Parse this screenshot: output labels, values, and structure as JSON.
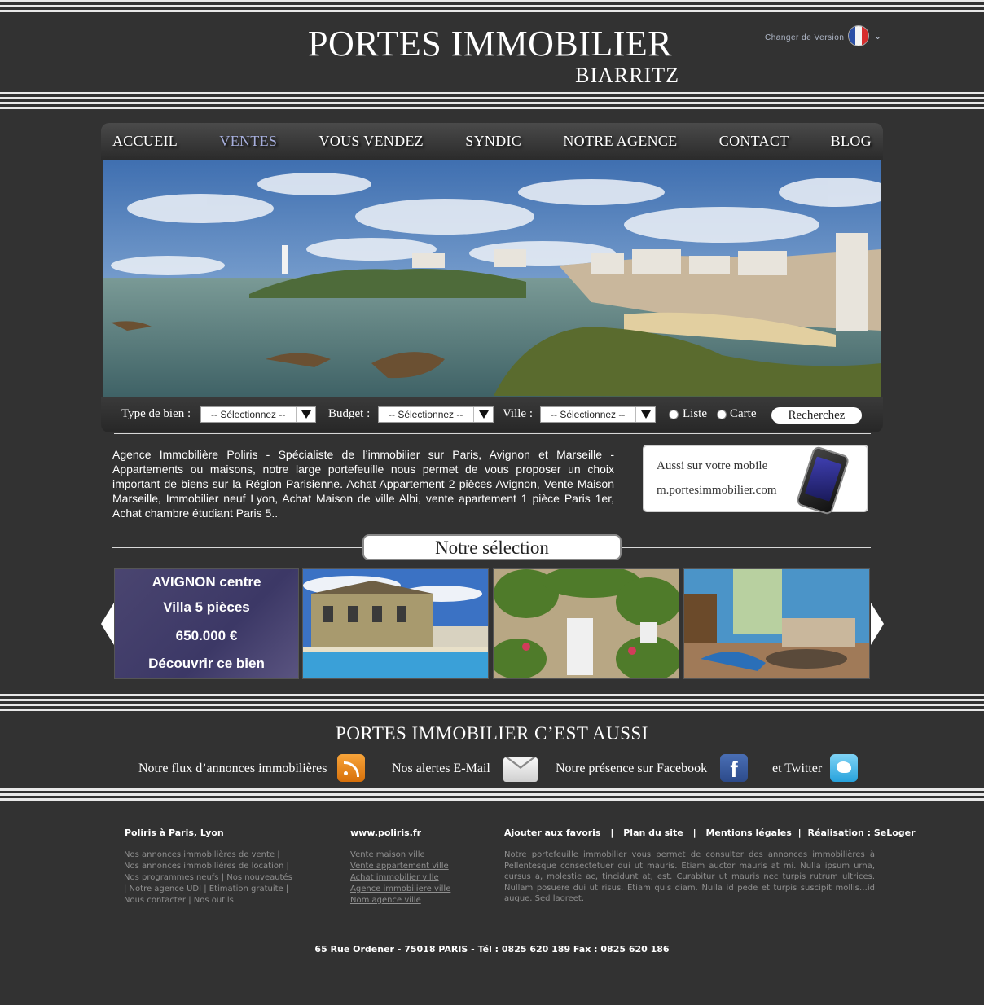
{
  "header": {
    "logo_line1": "PORTES IMMOBILIER",
    "logo_line2": "BIARRITZ",
    "version_label": "Changer de Version"
  },
  "nav": {
    "items": [
      {
        "label": "ACCUEIL"
      },
      {
        "label": "VENTES",
        "active": true
      },
      {
        "label": "VOUS VENDEZ"
      },
      {
        "label": "SYNDIC"
      },
      {
        "label": "NOTRE AGENCE"
      },
      {
        "label": "CONTACT"
      },
      {
        "label": "BLOG"
      }
    ]
  },
  "search": {
    "type_label": "Type de bien :",
    "type_value": "-- Sélectionnez --",
    "budget_label": "Budget :",
    "budget_value": "-- Sélectionnez --",
    "ville_label": "Ville :",
    "ville_value": "-- Sélectionnez --",
    "radio_liste": "Liste",
    "radio_carte": "Carte",
    "button_label": "Recherchez"
  },
  "intro": {
    "text": "Agence Immobilière Poliris - Spécialiste de l’immobilier sur Paris, Avignon et Marseille - Appartements ou maisons, notre large portefeuille nous permet de vous proposer un choix important de biens sur la Région Parisienne. Achat Appartement 2 pièces Avignon, Vente Maison Marseille, Immobilier neuf Lyon, Achat Maison de ville Albi, vente apartement 1 pièce Paris 1er, Achat chambre étudiant Paris 5.."
  },
  "mobile": {
    "line1": "Aussi sur votre mobile",
    "line2": "m.portesimmobilier.com"
  },
  "selection": {
    "title": "Notre sélection",
    "featured": {
      "city": "AVIGNON centre",
      "type": "Villa 5 pièces",
      "price": "650.000 €",
      "cta": "Découvrir ce bien"
    }
  },
  "aussi": {
    "title": "PORTES IMMOBILIER C’EST AUSSI",
    "flux": "Notre flux d’annonces immobilières",
    "alertes": "Nos alertes E-Mail",
    "facebook": "Notre présence sur Facebook",
    "twitter": "et Twitter",
    "fb_letter": "f"
  },
  "footer": {
    "col1_title": "Poliris à Paris, Lyon",
    "col1_lines": [
      "Nos annonces immobilières de vente |",
      "Nos annonces immobilières de location |",
      "Nos programmes neufs | Nos nouveautés",
      "| Notre agence UDI | Etimation gratuite |",
      "Nous contacter | Nos outils"
    ],
    "col2_title": "www.poliris.fr",
    "col2_links": [
      "Vente maison ville",
      "Vente appartement ville",
      "Achat immobilier ville",
      "Agence immobiliere ville",
      "Nom agence ville"
    ],
    "nav_links": [
      "Ajouter aux favoris",
      "Plan du site",
      "Mentions légales",
      "Réalisation : SeLoger"
    ],
    "paragraph": "Notre portefeuille immobilier vous permet de consulter des annonces immobilières à Pellentesque consectetuer dui ut mauris. Etiam auctor mauris at mi. Nulla ipsum urna, cursus a, molestie ac, tincidunt at, est. Curabitur ut mauris nec turpis rutrum ultrices. Nullam posuere dui ut risus. Etiam quis diam. Nulla id pede et turpis suscipit mollis…id augue. Sed laoreet.",
    "address": "65 Rue Ordener - 75018 PARIS  -  Tél : 0825 620 189  Fax : 0825 620 186"
  },
  "colors": {
    "background": "#323232",
    "nav_active": "#a6aedc",
    "card_purple": "#3c3866"
  }
}
